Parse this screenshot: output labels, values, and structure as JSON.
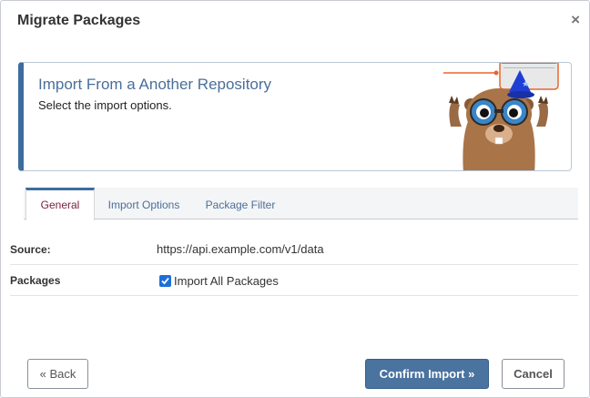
{
  "dialog": {
    "title": "Migrate Packages",
    "close_glyph": "×"
  },
  "banner": {
    "title": "Import From a Another Repository",
    "subtitle": "Select the import options."
  },
  "tabs": [
    {
      "label": "General",
      "active": true
    },
    {
      "label": "Import Options",
      "active": false
    },
    {
      "label": "Package Filter",
      "active": false
    }
  ],
  "general": {
    "source_label": "Source:",
    "source_value": "https://api.example.com/v1/data",
    "packages_label": "Packages",
    "import_all_label": "Import All Packages",
    "import_all_checked": true
  },
  "footer": {
    "back_label": "« Back",
    "confirm_label": "Confirm Import »",
    "cancel_label": "Cancel"
  },
  "colors": {
    "accent": "#3d6d9e",
    "primary_button": "#4a73a0",
    "active_tab_text": "#7a1f3d",
    "checkbox": "#1e6fd9"
  }
}
